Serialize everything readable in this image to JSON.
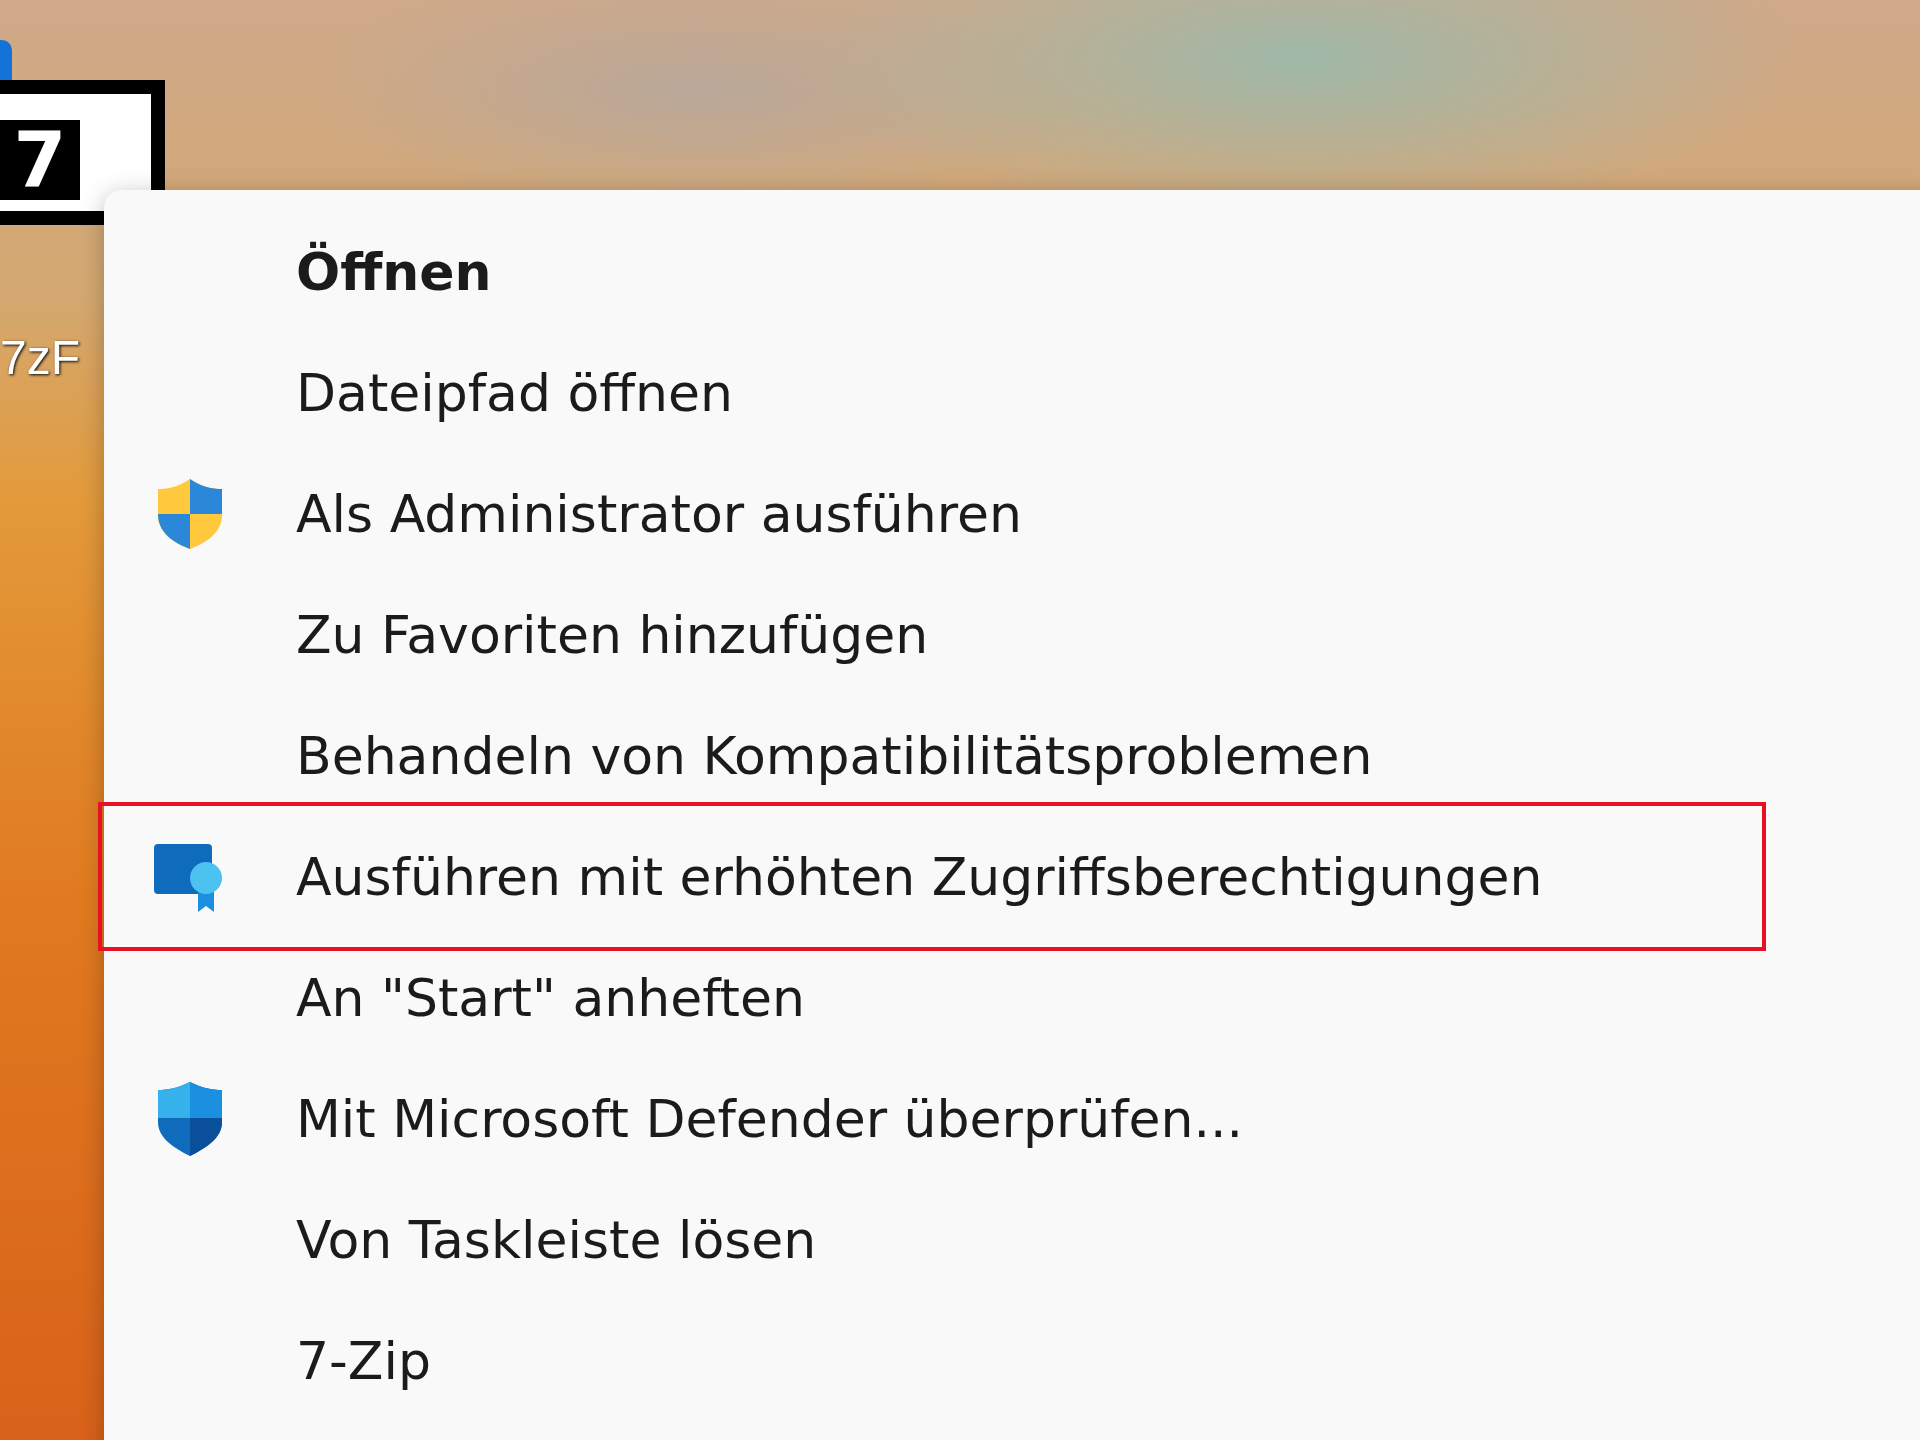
{
  "desktop_icon": {
    "logo_text": "7",
    "label": "7zF"
  },
  "context_menu": {
    "items": [
      {
        "label": "Öffnen",
        "default": true,
        "kind": "plain",
        "highlighted": false
      },
      {
        "label": "Dateipfad öffnen",
        "default": false,
        "kind": "plain",
        "highlighted": false
      },
      {
        "label": "Als Administrator ausführen",
        "default": false,
        "kind": "admin",
        "highlighted": false
      },
      {
        "label": "Zu Favoriten hinzufügen",
        "default": false,
        "kind": "plain",
        "highlighted": false
      },
      {
        "label": "Behandeln von Kompatibilitätsproblemen",
        "default": false,
        "kind": "plain",
        "highlighted": false
      },
      {
        "label": "Ausführen mit erhöhten Zugriffsberechtigungen",
        "default": false,
        "kind": "elevated",
        "highlighted": true
      },
      {
        "label": "An \"Start\" anheften",
        "default": false,
        "kind": "plain",
        "highlighted": false
      },
      {
        "label": "Mit Microsoft Defender überprüfen...",
        "default": false,
        "kind": "scan",
        "highlighted": false
      },
      {
        "label": "Von Taskleiste lösen",
        "default": false,
        "kind": "plain",
        "highlighted": false
      },
      {
        "label": "7-Zip",
        "default": false,
        "kind": "plain",
        "highlighted": false
      }
    ]
  }
}
